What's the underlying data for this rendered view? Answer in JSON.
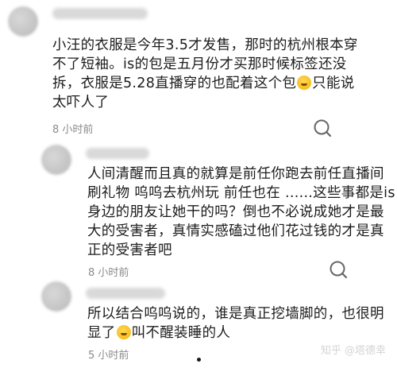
{
  "comments": [
    {
      "lines": [
        "小汪的衣服是今年3.5才发售，那时的杭州根本穿",
        "不了短袖。is的包是五月份才买那时候标签还没",
        "拆，衣服是5.28直播穿的也配着这个包",
        "太吓人了"
      ],
      "line3_suffix": "只能说",
      "time": "8 小时前"
    },
    {
      "lines": [
        "人间清醒而且真的就算是前任你跑去前任直播间",
        "刷礼物 呜呜去杭州玩 前任也在 ......这些事都是is",
        "身边的朋友让她干的吗？倒也不必说成她才是最",
        "大的受害者，真情实感磕过他们花过钱的才是真",
        "正的受害者吧"
      ],
      "time": "8 小时前"
    },
    {
      "lines_prefix": "所以结合呜呜说的，谁是真正挖墙脚的，也很明",
      "line2_prefix": "显了",
      "line2_suffix": "叫不醒装睡的人",
      "time": "5 小时前"
    }
  ],
  "icons": {
    "reply": "comment-bubble-icon",
    "emoji_laugh": "rofl-emoji",
    "emoji_hush": "zipper-mouth-emoji"
  },
  "watermark": "知乎 @塔德幸"
}
